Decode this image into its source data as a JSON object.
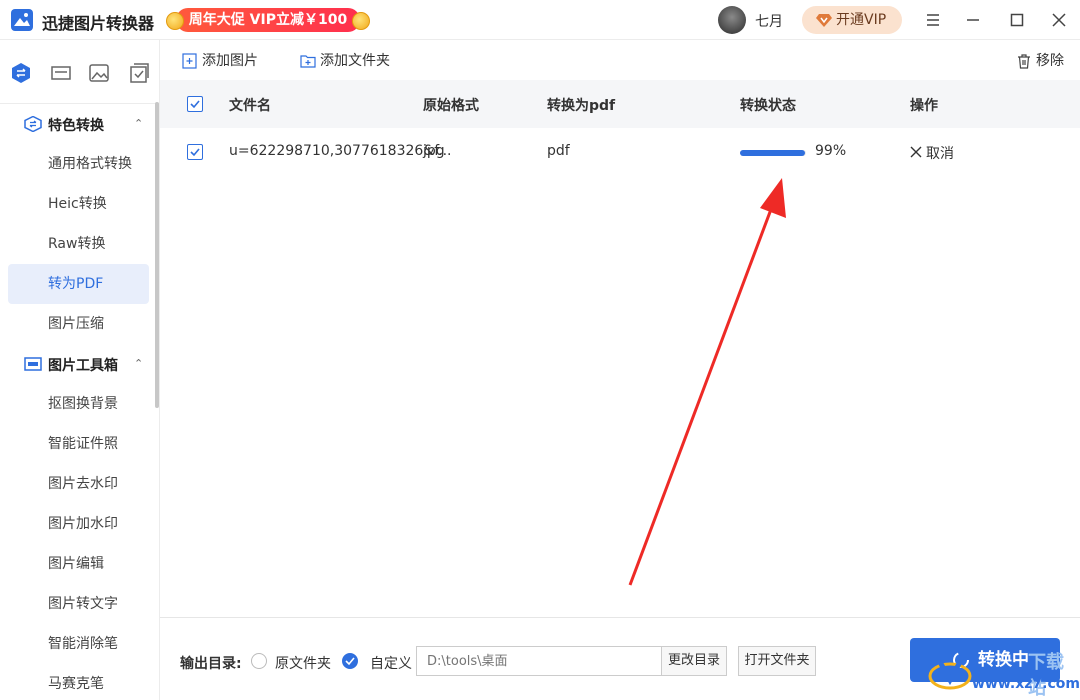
{
  "app": {
    "title": "迅捷图片转换器",
    "promo": "周年大促 VIP立减￥100",
    "username": "七月",
    "vip_label": "开通VIP"
  },
  "sidebar": {
    "groups": [
      {
        "label": "特色转换",
        "items": [
          "通用格式转换",
          "Heic转换",
          "Raw转换",
          "转为PDF",
          "图片压缩"
        ]
      },
      {
        "label": "图片工具箱",
        "items": [
          "抠图换背景",
          "智能证件照",
          "图片去水印",
          "图片加水印",
          "图片编辑",
          "图片转文字",
          "智能消除笔",
          "马赛克笔"
        ]
      }
    ],
    "active_item": "转为PDF"
  },
  "toolbar": {
    "add_image": "添加图片",
    "add_folder": "添加文件夹",
    "remove": "移除"
  },
  "table": {
    "headers": [
      "文件名",
      "原始格式",
      "转换为pdf",
      "转换状态",
      "操作"
    ],
    "rows": [
      {
        "filename": "u=622298710,3077618326&f...",
        "original_format": "jpg",
        "target_format": "pdf",
        "progress": 0.99,
        "progress_text": "99%",
        "action": "取消"
      }
    ]
  },
  "output": {
    "label": "输出目录:",
    "option_original": "原文件夹",
    "option_custom": "自定义",
    "selected": "custom",
    "path_placeholder": "D:\\tools\\桌面",
    "change_btn": "更改目录",
    "open_btn": "打开文件夹",
    "convert_btn": "转换中"
  },
  "watermark": {
    "text": "www.xz7.com",
    "cn": "下载站"
  },
  "colors": {
    "accent": "#2f6fde",
    "promo": "#ff3a4a",
    "annotation_arrow": "#ee2a26"
  }
}
